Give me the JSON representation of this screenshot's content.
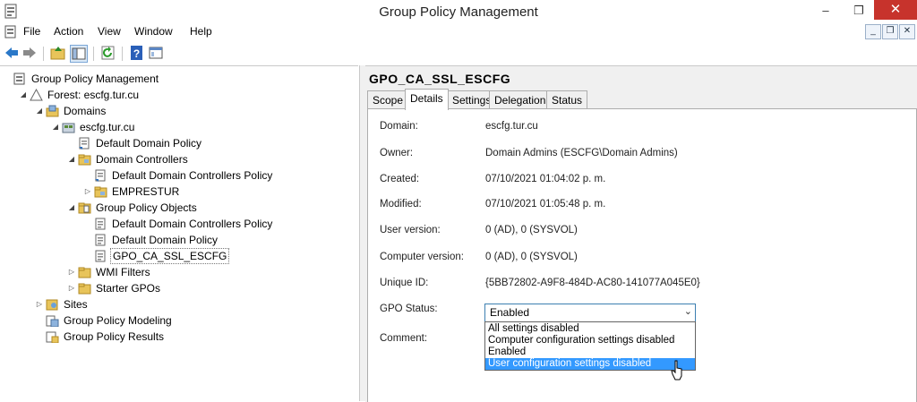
{
  "window": {
    "title": "Group Policy Management"
  },
  "window_controls": {
    "minimize": "–",
    "restore": "❐",
    "close": "✕"
  },
  "menu": [
    "File",
    "Action",
    "View",
    "Window",
    "Help"
  ],
  "mdi_controls": {
    "minimize": "_",
    "restore": "❐",
    "close": "✕"
  },
  "toolbar": [
    "back",
    "forward",
    "up-folder",
    "show-hide-tree",
    "refresh",
    "help",
    "properties"
  ],
  "tree": [
    {
      "label": "Group Policy Management",
      "icon": "gpm-icon"
    },
    {
      "label": "Forest: escfg.tur.cu",
      "icon": "forest-icon"
    },
    {
      "label": "Domains",
      "icon": "domains-icon"
    },
    {
      "label": "escfg.tur.cu",
      "icon": "domain-icon"
    },
    {
      "label": "Default Domain Policy",
      "icon": "gpo-link-icon"
    },
    {
      "label": "Domain Controllers",
      "icon": "ou-icon"
    },
    {
      "label": "Default Domain Controllers Policy",
      "icon": "gpo-link-icon"
    },
    {
      "label": "EMPRESTUR",
      "icon": "ou-icon"
    },
    {
      "label": "Group Policy Objects",
      "icon": "gpo-folder-icon"
    },
    {
      "label": "Default Domain Controllers Policy",
      "icon": "gpo-icon"
    },
    {
      "label": "Default Domain Policy",
      "icon": "gpo-icon"
    },
    {
      "label": "GPO_CA_SSL_ESCFG",
      "icon": "gpo-icon"
    },
    {
      "label": "WMI Filters",
      "icon": "folder-icon"
    },
    {
      "label": "Starter GPOs",
      "icon": "folder-icon"
    },
    {
      "label": "Sites",
      "icon": "sites-icon"
    },
    {
      "label": "Group Policy Modeling",
      "icon": "modeling-icon"
    },
    {
      "label": "Group Policy Results",
      "icon": "results-icon"
    }
  ],
  "gpo": {
    "title": "GPO_CA_SSL_ESCFG",
    "tabs": [
      "Scope",
      "Details",
      "Settings",
      "Delegation",
      "Status"
    ],
    "active_tab": "Details",
    "fields": [
      {
        "label": "Domain:",
        "value": "escfg.tur.cu"
      },
      {
        "label": "Owner:",
        "value": "Domain Admins (ESCFG\\Domain Admins)"
      },
      {
        "label": "Created:",
        "value": "07/10/2021 01:04:02 p. m."
      },
      {
        "label": "Modified:",
        "value": "07/10/2021 01:05:48 p. m."
      },
      {
        "label": "User version:",
        "value": "0 (AD), 0 (SYSVOL)"
      },
      {
        "label": "Computer version:",
        "value": "0 (AD), 0 (SYSVOL)"
      },
      {
        "label": "Unique ID:",
        "value": "{5BB72802-A9F8-484D-AC80-141077A045E0}"
      }
    ],
    "status_label": "GPO Status:",
    "status_value": "Enabled",
    "status_options": [
      "All settings disabled",
      "Computer configuration settings disabled",
      "Enabled",
      "User configuration settings disabled"
    ],
    "comment_label": "Comment:"
  },
  "colors": {
    "highlight": "#3399ff",
    "close": "#c7332c"
  }
}
